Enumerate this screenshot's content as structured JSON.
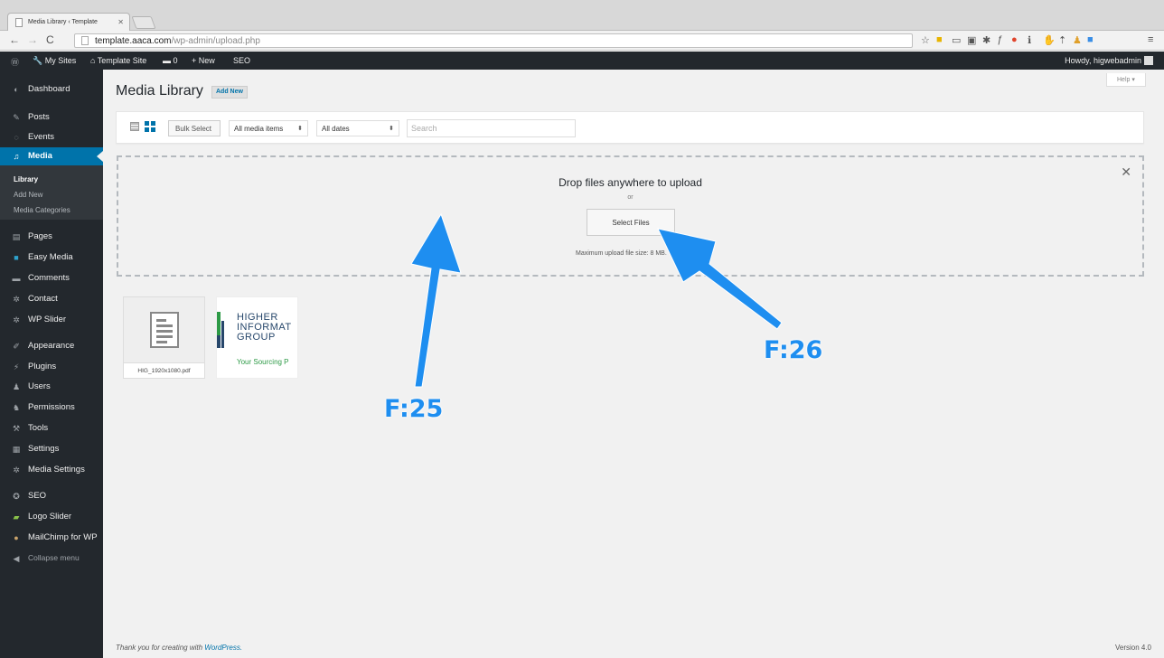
{
  "browser": {
    "tab_title": "Media Library ‹ Template",
    "url_host": "template.aaca.com",
    "url_path": "/wp-admin/upload.php"
  },
  "adminbar": {
    "my_sites": "My Sites",
    "site_name": "Template Site",
    "comments_count": "0",
    "new_label": "+ New",
    "seo": "SEO",
    "howdy": "Howdy, higwebadmin"
  },
  "sidebar": {
    "items": [
      {
        "label": "Dashboard",
        "icon": "dashboard-icon"
      },
      {
        "label": "Posts",
        "icon": "pin-icon"
      },
      {
        "label": "Events",
        "icon": "events-icon"
      },
      {
        "label": "Media",
        "icon": "media-icon"
      },
      {
        "label": "Pages",
        "icon": "pages-icon"
      },
      {
        "label": "Easy Media",
        "icon": "easy-media-icon"
      },
      {
        "label": "Comments",
        "icon": "comments-icon"
      },
      {
        "label": "Contact",
        "icon": "contact-icon"
      },
      {
        "label": "WP Slider",
        "icon": "slider-icon"
      },
      {
        "label": "Appearance",
        "icon": "brush-icon"
      },
      {
        "label": "Plugins",
        "icon": "plug-icon"
      },
      {
        "label": "Users",
        "icon": "users-icon"
      },
      {
        "label": "Permissions",
        "icon": "permissions-icon"
      },
      {
        "label": "Tools",
        "icon": "wrench-icon"
      },
      {
        "label": "Settings",
        "icon": "settings-icon"
      },
      {
        "label": "Media Settings",
        "icon": "gear-icon"
      },
      {
        "label": "SEO",
        "icon": "seo-icon"
      },
      {
        "label": "Logo Slider",
        "icon": "logo-slider-icon"
      },
      {
        "label": "MailChimp for WP",
        "icon": "mailchimp-icon"
      },
      {
        "label": "Collapse menu",
        "icon": "collapse-icon"
      }
    ],
    "media_sub": [
      "Library",
      "Add New",
      "Media Categories"
    ]
  },
  "main": {
    "title": "Media Library",
    "add_new": "Add New",
    "help": "Help ▾",
    "filter": {
      "bulk_select": "Bulk Select",
      "type_filter": "All media items",
      "date_filter": "All dates",
      "search_placeholder": "Search"
    },
    "upload": {
      "title": "Drop files anywhere to upload",
      "or": "or",
      "button": "Select Files",
      "max_size": "Maximum upload file size: 8 MB."
    },
    "attachments": [
      {
        "filename": "HIG_1920x1080.pdf"
      },
      {
        "logo_lines": [
          "HIGHER",
          "INFORMAT",
          "GROUP"
        ],
        "tagline": "Your Sourcing P"
      }
    ],
    "footer_thanks": "Thank you for creating with",
    "footer_wp": "WordPress.",
    "version": "Version 4.0"
  },
  "annotations": {
    "label_a": "F:25",
    "label_b": "F:26",
    "color": "#1e8ef0"
  }
}
